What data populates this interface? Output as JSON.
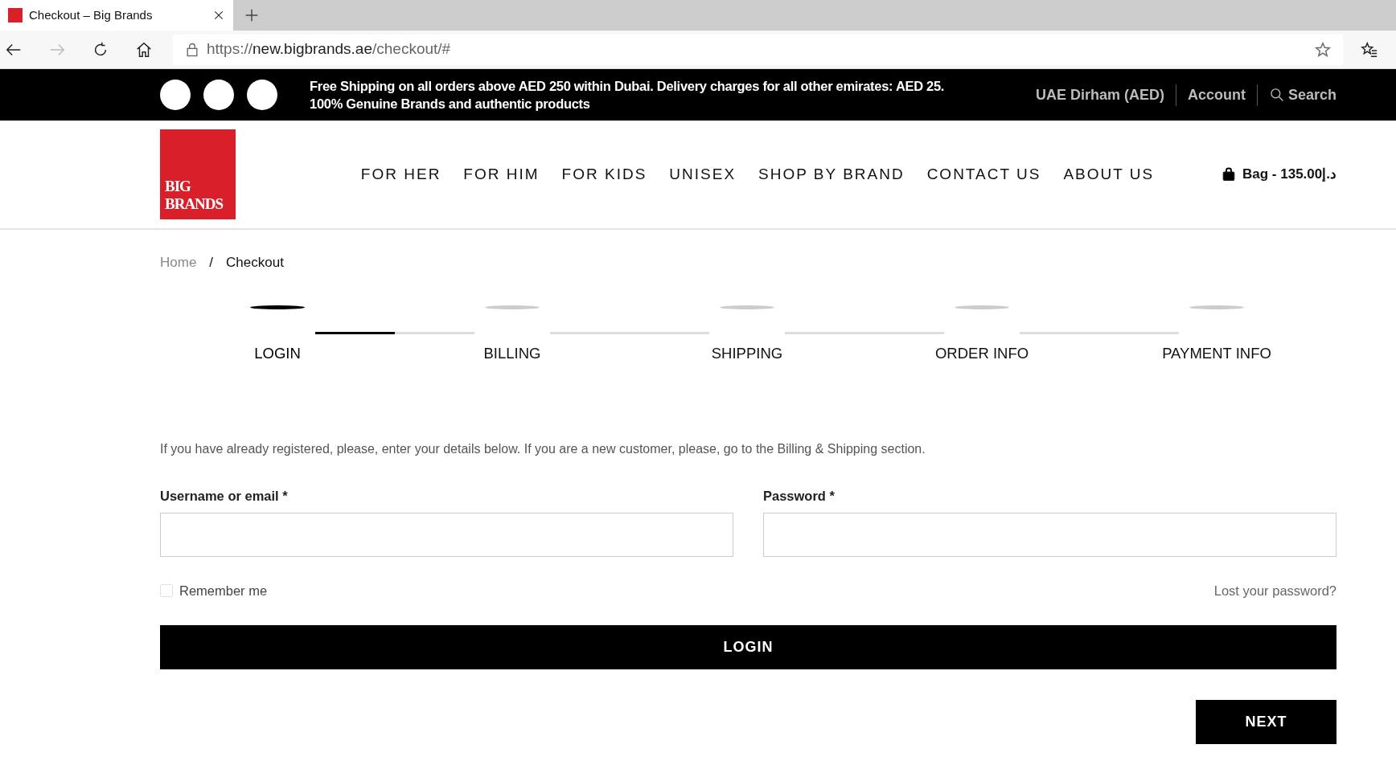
{
  "browser": {
    "tab_title": "Checkout – Big Brands",
    "url_scheme": "https://",
    "url_host": "new.bigbrands.ae",
    "url_path": "/checkout/#",
    "forward_disabled": true
  },
  "top_bar": {
    "messages": [
      "Free Shipping on all orders above AED 250 within Dubai. Delivery charges for all other emirates: AED 25.",
      "100% Genuine Brands and authentic products"
    ],
    "currency": "UAE Dirham (AED)",
    "account": "Account",
    "search": "Search"
  },
  "logo": {
    "lines": [
      "BIG",
      "BRANDS"
    ]
  },
  "nav": [
    "FOR HER",
    "FOR HIM",
    "FOR KIDS",
    "UNISEX",
    "SHOP BY BRAND",
    "CONTACT US",
    "ABOUT US"
  ],
  "bag": "Bag - 135.00د.إ",
  "breadcrumb": [
    {
      "label": "Home",
      "current": false
    },
    {
      "label": "Checkout",
      "current": true
    }
  ],
  "breadcrumb_separator": "/",
  "steps": [
    {
      "label": "LOGIN",
      "selected": true
    },
    {
      "label": "BILLING",
      "selected": false
    },
    {
      "label": "SHIPPING",
      "selected": false
    },
    {
      "label": "ORDER INFO",
      "selected": false
    },
    {
      "label": "PAYMENT INFO",
      "selected": false
    }
  ],
  "step_progress": {
    "level": 0.5
  },
  "intro": "If you have already registered, please, enter your details below. If you are a new customer, please, go to the Billing & Shipping section.",
  "fields": [
    {
      "label": "Username or email *"
    },
    {
      "label": "Password *"
    }
  ],
  "remember": {
    "label": "Remember me",
    "checked": false
  },
  "lost_password": "Lost your password?",
  "login_button": "LOGIN",
  "next_button": "NEXT"
}
